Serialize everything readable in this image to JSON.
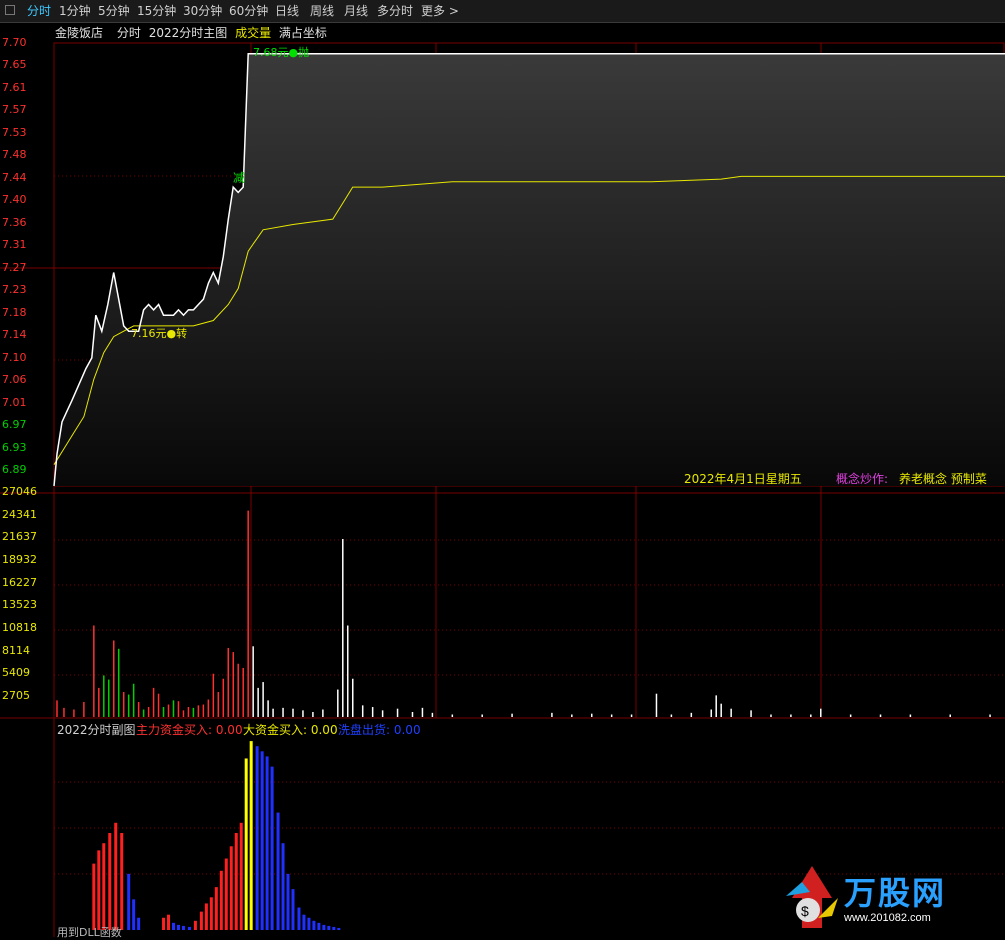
{
  "tabs": [
    {
      "label": "分时",
      "active": true
    },
    {
      "label": "1分钟",
      "active": false
    },
    {
      "label": "5分钟",
      "active": false
    },
    {
      "label": "15分钟",
      "active": false
    },
    {
      "label": "30分钟",
      "active": false
    },
    {
      "label": "60分钟",
      "active": false
    },
    {
      "label": "日线",
      "active": false
    },
    {
      "label": "周线",
      "active": false
    },
    {
      "label": "月线",
      "active": false
    },
    {
      "label": "多分时",
      "active": false
    },
    {
      "label": "更多 >",
      "active": false
    }
  ],
  "header": {
    "stock_name": "金陵饭店",
    "mode": "分时",
    "indicator": "2022分时主图",
    "volume_label": "成交量",
    "fill_coord": "满占坐标"
  },
  "price_axis": [
    "7.70",
    "7.65",
    "7.61",
    "7.57",
    "7.53",
    "7.48",
    "7.44",
    "7.40",
    "7.36",
    "7.31",
    "7.27",
    "7.23",
    "7.18",
    "7.14",
    "7.10",
    "7.06",
    "7.01",
    "6.97",
    "6.93",
    "6.89"
  ],
  "volume_axis": [
    "27046",
    "24341",
    "21637",
    "18932",
    "16227",
    "13523",
    "10818",
    "8114",
    "5409",
    "2705"
  ],
  "annotations": {
    "high_label": "7.68元●抛",
    "low_label": "7.16元●转",
    "sell_mark": "减",
    "date_label": "2022年4月1日星期五",
    "concept_label": "概念炒作:",
    "concept_value": "养老概念 预制菜"
  },
  "sub_header": {
    "title": "2022分时副图",
    "main_fund": "主力资金买入: 0.00",
    "big_fund": "大资金买入: 0.00",
    "wash": "洗盘出货: 0.00"
  },
  "footer_text": "用到DLL函数",
  "watermark": {
    "logo": "万股网",
    "url": "www.201082.com"
  },
  "colors": {
    "up": "#ff3030",
    "down": "#00d000",
    "avg": "#e8e800",
    "grid": "#7a0000",
    "main_fund": "#ff2020",
    "big_fund": "#ffff00",
    "wash": "#2030ff"
  },
  "chart_data": {
    "type": "line",
    "price_series": [
      [
        0,
        6.87
      ],
      [
        3,
        6.93
      ],
      [
        8,
        6.99
      ],
      [
        13,
        7.01
      ],
      [
        18,
        7.03
      ],
      [
        25,
        7.06
      ],
      [
        32,
        7.09
      ],
      [
        38,
        7.11
      ],
      [
        42,
        7.19
      ],
      [
        48,
        7.16
      ],
      [
        54,
        7.21
      ],
      [
        60,
        7.27
      ],
      [
        65,
        7.22
      ],
      [
        70,
        7.17
      ],
      [
        75,
        7.16
      ],
      [
        80,
        7.16
      ],
      [
        85,
        7.16
      ],
      [
        90,
        7.2
      ],
      [
        95,
        7.21
      ],
      [
        100,
        7.2
      ],
      [
        105,
        7.21
      ],
      [
        110,
        7.19
      ],
      [
        115,
        7.19
      ],
      [
        120,
        7.19
      ],
      [
        125,
        7.2
      ],
      [
        130,
        7.19
      ],
      [
        135,
        7.2
      ],
      [
        140,
        7.2
      ],
      [
        145,
        7.21
      ],
      [
        150,
        7.22
      ],
      [
        155,
        7.25
      ],
      [
        160,
        7.27
      ],
      [
        165,
        7.25
      ],
      [
        170,
        7.3
      ],
      [
        175,
        7.37
      ],
      [
        180,
        7.43
      ],
      [
        185,
        7.42
      ],
      [
        190,
        7.43
      ],
      [
        195,
        7.68
      ],
      [
        200,
        7.68
      ],
      [
        955,
        7.68
      ]
    ],
    "avg_series": [
      [
        0,
        6.91
      ],
      [
        10,
        6.94
      ],
      [
        20,
        6.97
      ],
      [
        30,
        7.0
      ],
      [
        40,
        7.07
      ],
      [
        50,
        7.12
      ],
      [
        60,
        7.15
      ],
      [
        70,
        7.16
      ],
      [
        80,
        7.17
      ],
      [
        100,
        7.17
      ],
      [
        120,
        7.17
      ],
      [
        140,
        7.17
      ],
      [
        160,
        7.18
      ],
      [
        175,
        7.21
      ],
      [
        185,
        7.24
      ],
      [
        195,
        7.31
      ],
      [
        210,
        7.35
      ],
      [
        240,
        7.36
      ],
      [
        280,
        7.37
      ],
      [
        290,
        7.4
      ],
      [
        300,
        7.43
      ],
      [
        330,
        7.43
      ],
      [
        400,
        7.44
      ],
      [
        500,
        7.44
      ],
      [
        600,
        7.44
      ],
      [
        670,
        7.445
      ],
      [
        690,
        7.45
      ],
      [
        800,
        7.45
      ],
      [
        955,
        7.45
      ]
    ],
    "volume_bars": [
      [
        3,
        2000,
        "up"
      ],
      [
        10,
        1100,
        "up"
      ],
      [
        20,
        900,
        "up"
      ],
      [
        30,
        1800,
        "up"
      ],
      [
        40,
        11000,
        "up"
      ],
      [
        45,
        3500,
        "up"
      ],
      [
        50,
        5000,
        "down"
      ],
      [
        55,
        4500,
        "down"
      ],
      [
        60,
        9200,
        "up"
      ],
      [
        65,
        8200,
        "down"
      ],
      [
        70,
        3000,
        "up"
      ],
      [
        75,
        2700,
        "down"
      ],
      [
        80,
        4000,
        "down"
      ],
      [
        85,
        1800,
        "up"
      ],
      [
        90,
        900,
        "down"
      ],
      [
        95,
        1200,
        "up"
      ],
      [
        100,
        3500,
        "up"
      ],
      [
        105,
        2800,
        "up"
      ],
      [
        110,
        1200,
        "down"
      ],
      [
        115,
        1500,
        "up"
      ],
      [
        120,
        2000,
        "down"
      ],
      [
        125,
        1900,
        "up"
      ],
      [
        130,
        800,
        "up"
      ],
      [
        135,
        1200,
        "up"
      ],
      [
        140,
        1100,
        "down"
      ],
      [
        145,
        1400,
        "up"
      ],
      [
        150,
        1500,
        "up"
      ],
      [
        155,
        2100,
        "up"
      ],
      [
        160,
        5200,
        "up"
      ],
      [
        165,
        3000,
        "up"
      ],
      [
        170,
        4600,
        "up"
      ],
      [
        175,
        8300,
        "up"
      ],
      [
        180,
        7800,
        "up"
      ],
      [
        185,
        6400,
        "up"
      ],
      [
        190,
        5900,
        "up"
      ],
      [
        195,
        24800,
        "up"
      ],
      [
        200,
        8500,
        "white"
      ],
      [
        205,
        3500,
        "white"
      ],
      [
        210,
        4200,
        "white"
      ],
      [
        215,
        2000,
        "white"
      ],
      [
        220,
        1000,
        "white"
      ],
      [
        230,
        1100,
        "white"
      ],
      [
        240,
        1000,
        "white"
      ],
      [
        250,
        800,
        "white"
      ],
      [
        260,
        600,
        "white"
      ],
      [
        270,
        900,
        "white"
      ],
      [
        285,
        3300,
        "white"
      ],
      [
        290,
        21400,
        "white"
      ],
      [
        295,
        11000,
        "white"
      ],
      [
        300,
        4600,
        "white"
      ],
      [
        310,
        1400,
        "white"
      ],
      [
        320,
        1200,
        "white"
      ],
      [
        330,
        800,
        "white"
      ],
      [
        345,
        1000,
        "white"
      ],
      [
        360,
        600,
        "white"
      ],
      [
        370,
        1100,
        "white"
      ],
      [
        380,
        500,
        "white"
      ],
      [
        400,
        300,
        "white"
      ],
      [
        430,
        300,
        "white"
      ],
      [
        460,
        400,
        "white"
      ],
      [
        500,
        500,
        "white"
      ],
      [
        520,
        300,
        "white"
      ],
      [
        540,
        400,
        "white"
      ],
      [
        560,
        300,
        "white"
      ],
      [
        580,
        300,
        "white"
      ],
      [
        605,
        2800,
        "white"
      ],
      [
        620,
        300,
        "white"
      ],
      [
        640,
        500,
        "white"
      ],
      [
        660,
        900,
        "white"
      ],
      [
        665,
        2600,
        "white"
      ],
      [
        670,
        1600,
        "white"
      ],
      [
        680,
        1000,
        "white"
      ],
      [
        700,
        800,
        "white"
      ],
      [
        720,
        300,
        "white"
      ],
      [
        740,
        300,
        "white"
      ],
      [
        760,
        300,
        "white"
      ],
      [
        770,
        1000,
        "white"
      ],
      [
        800,
        300,
        "white"
      ],
      [
        830,
        300,
        "white"
      ],
      [
        860,
        300,
        "white"
      ],
      [
        900,
        300,
        "white"
      ],
      [
        940,
        300,
        "white"
      ]
    ],
    "fund_bars": [
      [
        40,
        65,
        "main"
      ],
      [
        45,
        78,
        "main"
      ],
      [
        50,
        85,
        "main"
      ],
      [
        56,
        95,
        "main"
      ],
      [
        62,
        105,
        "main"
      ],
      [
        68,
        95,
        "main"
      ],
      [
        75,
        55,
        "wash"
      ],
      [
        80,
        30,
        "wash"
      ],
      [
        85,
        12,
        "wash"
      ],
      [
        110,
        12,
        "main"
      ],
      [
        115,
        15,
        "main"
      ],
      [
        120,
        7,
        "wash"
      ],
      [
        125,
        5,
        "wash"
      ],
      [
        130,
        4,
        "wash"
      ],
      [
        136,
        3,
        "wash"
      ],
      [
        142,
        9,
        "main"
      ],
      [
        148,
        18,
        "main"
      ],
      [
        153,
        26,
        "main"
      ],
      [
        158,
        32,
        "main"
      ],
      [
        163,
        42,
        "main"
      ],
      [
        168,
        58,
        "main"
      ],
      [
        173,
        70,
        "main"
      ],
      [
        178,
        82,
        "main"
      ],
      [
        183,
        95,
        "main"
      ],
      [
        188,
        105,
        "main"
      ],
      [
        193,
        168,
        "big"
      ],
      [
        198,
        185,
        "big"
      ],
      [
        204,
        180,
        "wash"
      ],
      [
        209,
        175,
        "wash"
      ],
      [
        214,
        170,
        "wash"
      ],
      [
        219,
        160,
        "wash"
      ],
      [
        225,
        115,
        "wash"
      ],
      [
        230,
        85,
        "wash"
      ],
      [
        235,
        55,
        "wash"
      ],
      [
        240,
        40,
        "wash"
      ],
      [
        246,
        22,
        "wash"
      ],
      [
        251,
        15,
        "wash"
      ],
      [
        256,
        12,
        "wash"
      ],
      [
        261,
        9,
        "wash"
      ],
      [
        266,
        7,
        "wash"
      ],
      [
        271,
        5,
        "wash"
      ],
      [
        276,
        4,
        "wash"
      ],
      [
        281,
        3,
        "wash"
      ],
      [
        286,
        2,
        "wash"
      ]
    ],
    "x_range": [
      0,
      955
    ],
    "price_ylim": [
      6.87,
      7.7
    ],
    "volume_ylim": [
      0,
      27046
    ],
    "fund_ylim": [
      0,
      190
    ]
  }
}
